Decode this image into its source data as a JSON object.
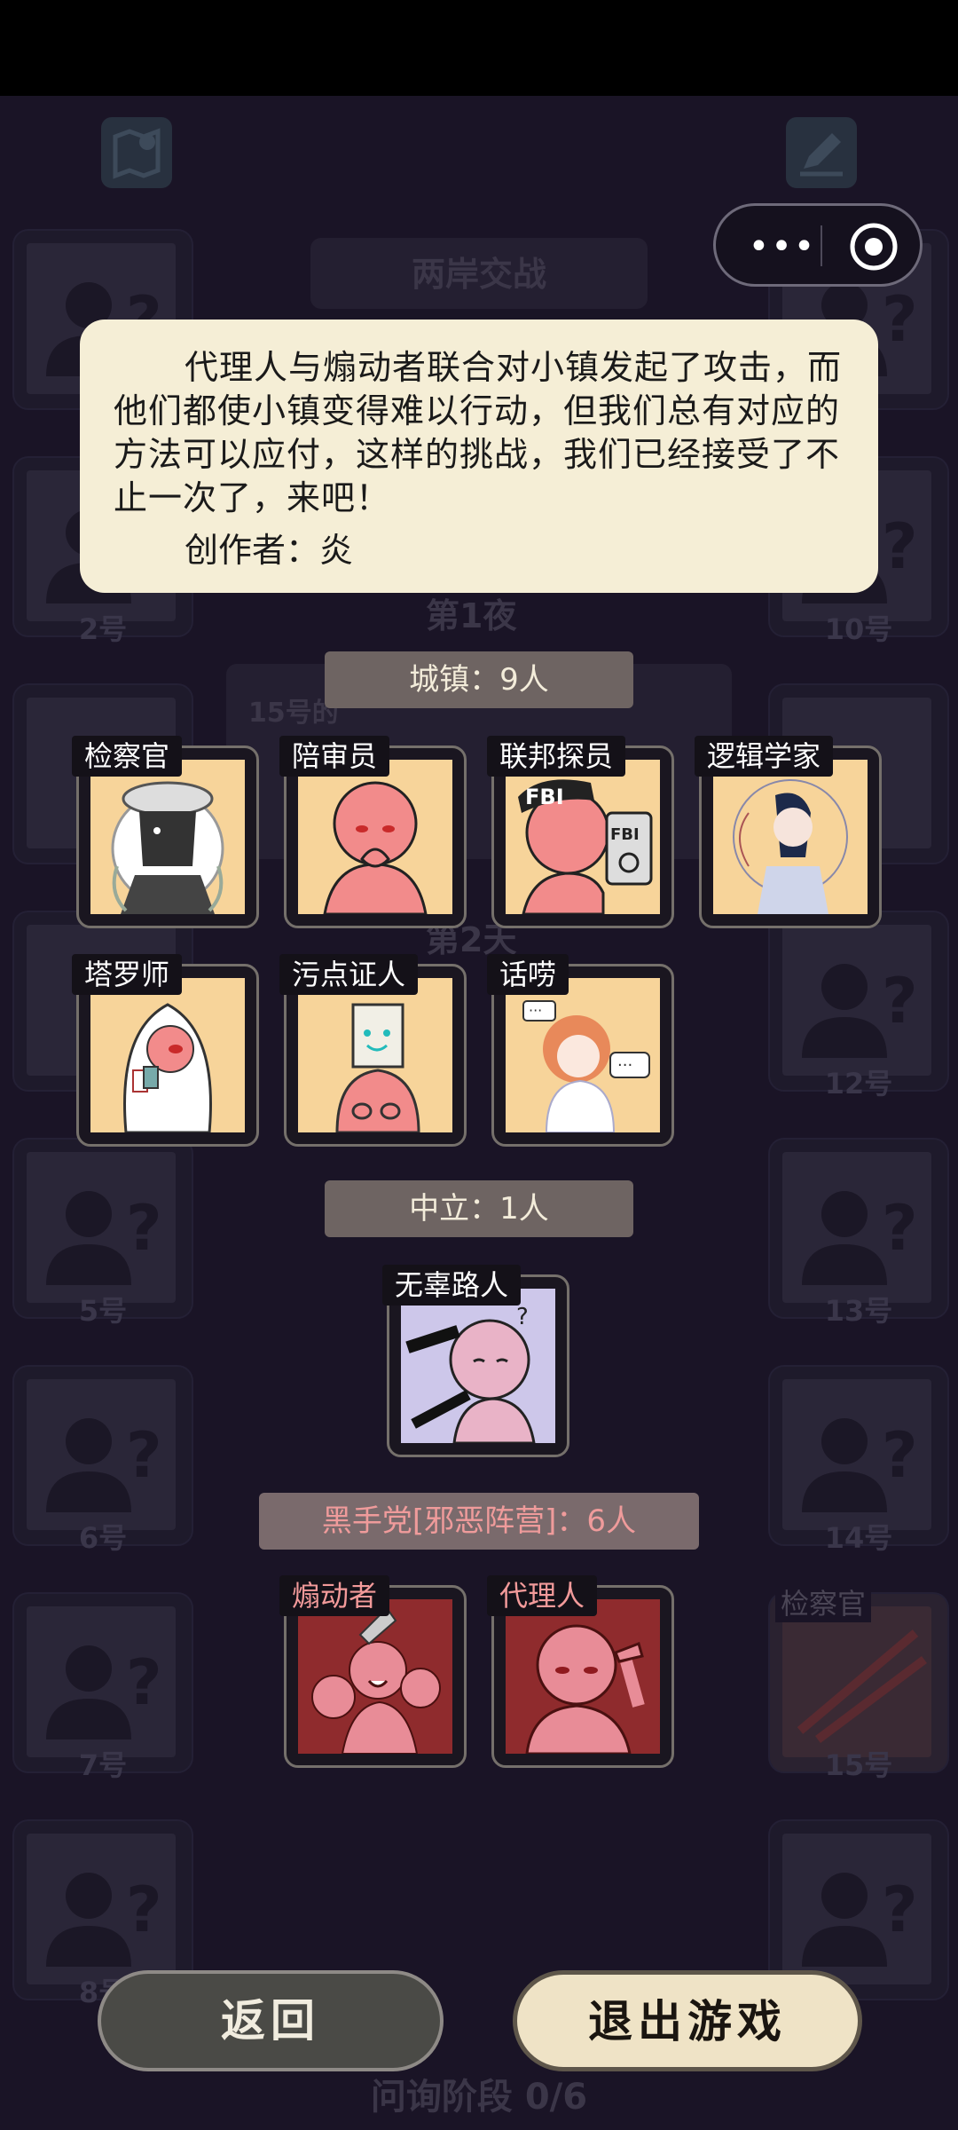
{
  "background": {
    "top_title": "两岸交战",
    "night_label": "第1夜",
    "night2_label": "第2天",
    "hint_text": "15号的",
    "left_numbers": [
      "2号",
      "5号",
      "6号",
      "7号",
      "8号"
    ],
    "right_numbers": [
      "10号",
      "12号",
      "13号",
      "14号",
      "15号"
    ],
    "dead_player_role": "检察官",
    "phase": "问询阶段 0/6"
  },
  "scenario": {
    "description": "代理人与煽动者联合对小镇发起了攻击，而他们都使小镇变得难以行动，但我们总有对应的方法可以应付，这样的挑战，我们已经接受了不止一次了，来吧！",
    "author": "创作者：炎"
  },
  "factions": {
    "town": {
      "label": "城镇：9人",
      "roles": [
        "检察官",
        "陪审员",
        "联邦探员",
        "逻辑学家",
        "塔罗师",
        "污点证人",
        "话唠"
      ]
    },
    "neutral": {
      "label": "中立：1人",
      "roles": [
        "无辜路人"
      ]
    },
    "evil": {
      "label": "黑手党[邪恶阵营]：6人",
      "roles": [
        "煽动者",
        "代理人"
      ]
    }
  },
  "buttons": {
    "back": "返回",
    "exit": "退出游戏"
  },
  "icons": {
    "map": "map-icon",
    "edit": "pencil-icon",
    "menu": "more-dots-icon",
    "close": "target-circle-icon",
    "placeholder": "unknown-user-icon"
  },
  "colors": {
    "background": "#1d1729",
    "card_panel": "#f5eed6",
    "town_art": "#f7d49a",
    "evil_art": "#8f2b2d",
    "evil_text": "#ef9b9b"
  }
}
